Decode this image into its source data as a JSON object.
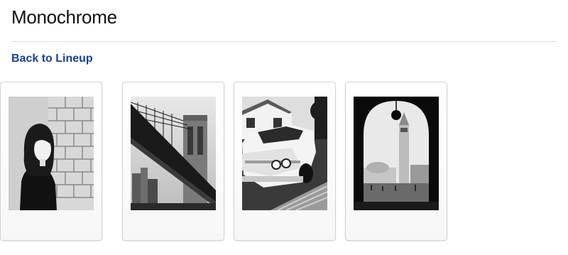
{
  "page": {
    "title": "Monochrome",
    "back_link_label": "Back to Lineup"
  },
  "photos": [
    {
      "subject": "bridge"
    },
    {
      "subject": "vintage-car"
    },
    {
      "subject": "archway-plaza"
    },
    {
      "subject": "woman-brick-wall"
    }
  ],
  "colors": {
    "link": "#1a3f96",
    "title": "#111111",
    "divider": "#dcdcdc"
  }
}
